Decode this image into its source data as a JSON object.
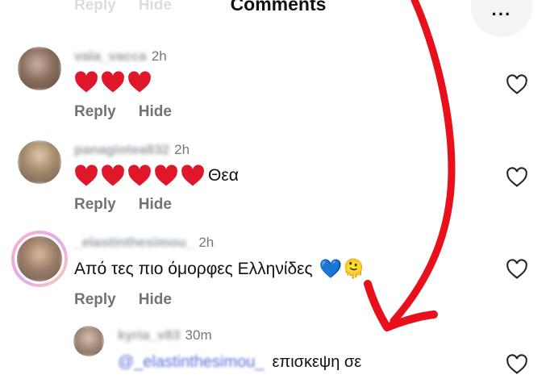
{
  "header": {
    "title": "Comments",
    "more_label": "···"
  },
  "previous_actions": {
    "reply": "Reply",
    "hide": "Hide"
  },
  "comments": [
    {
      "username": "vala_vacca",
      "time": "2h",
      "hearts": 3,
      "text": "",
      "reply": "Reply",
      "hide": "Hide"
    },
    {
      "username": "panagiotea832",
      "time": "2h",
      "hearts": 5,
      "text": "Θεα",
      "reply": "Reply",
      "hide": "Hide"
    },
    {
      "username": "_elastinthesimou_",
      "time": "2h",
      "hearts": 0,
      "text": "Από τες πιο όμορφες Ελληνίδες",
      "emoji": "💙🫠",
      "reply": "Reply",
      "hide": "Hide"
    }
  ],
  "reply": {
    "username": "kyria_v83",
    "time": "30m",
    "mention": "@_elastinthesimou_",
    "text": "επισκεψη σε"
  },
  "colors": {
    "annotation_arrow": "#e8101a",
    "heart": "#e0162b",
    "text": "#111111",
    "muted": "#737373"
  },
  "icons": {
    "like": "heart-outline-icon",
    "more": "more-horizontal-icon"
  }
}
